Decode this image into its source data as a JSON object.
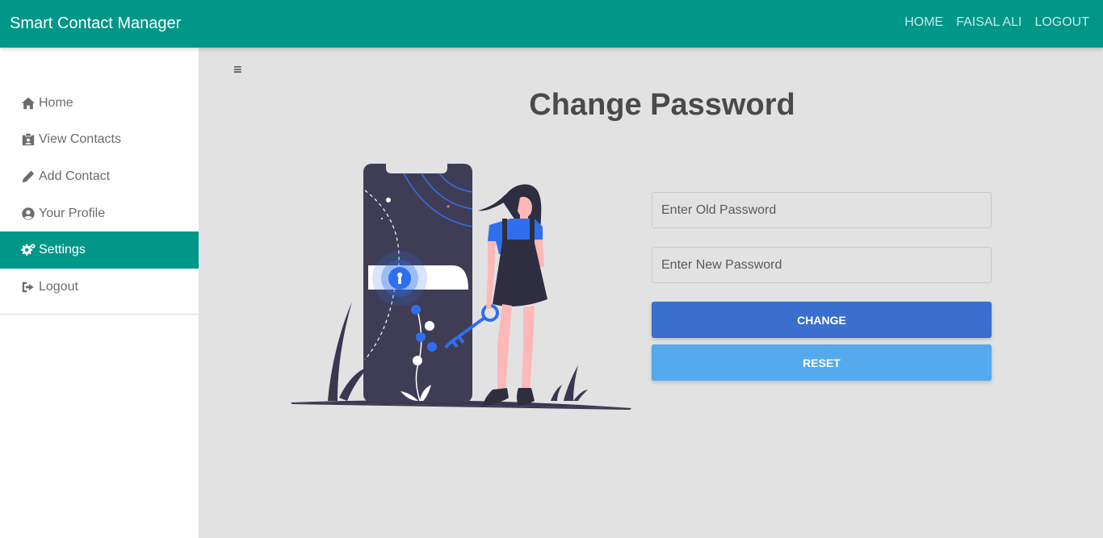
{
  "navbar": {
    "brand": "Smart Contact Manager",
    "links": [
      {
        "label": "HOME"
      },
      {
        "label": "FAISAL ALI"
      },
      {
        "label": "LOGOUT"
      }
    ]
  },
  "sidebar": {
    "items": [
      {
        "label": "Home",
        "icon": "home-icon"
      },
      {
        "label": "View Contacts",
        "icon": "id-badge-icon"
      },
      {
        "label": "Add Contact",
        "icon": "pencil-icon"
      },
      {
        "label": "Your Profile",
        "icon": "user-circle-icon"
      },
      {
        "label": "Settings",
        "icon": "gears-icon",
        "active": true
      },
      {
        "label": "Logout",
        "icon": "sign-out-icon"
      }
    ]
  },
  "content": {
    "menu_toggle": "≡",
    "title": "Change Password",
    "form": {
      "old_password_placeholder": "Enter Old Password",
      "new_password_placeholder": "Enter New Password",
      "change_label": "CHANGE",
      "reset_label": "RESET"
    }
  },
  "colors": {
    "primary": "#009688",
    "change_button": "#3b6fcd",
    "reset_button": "#55aaee",
    "background": "#e2e2e2"
  }
}
